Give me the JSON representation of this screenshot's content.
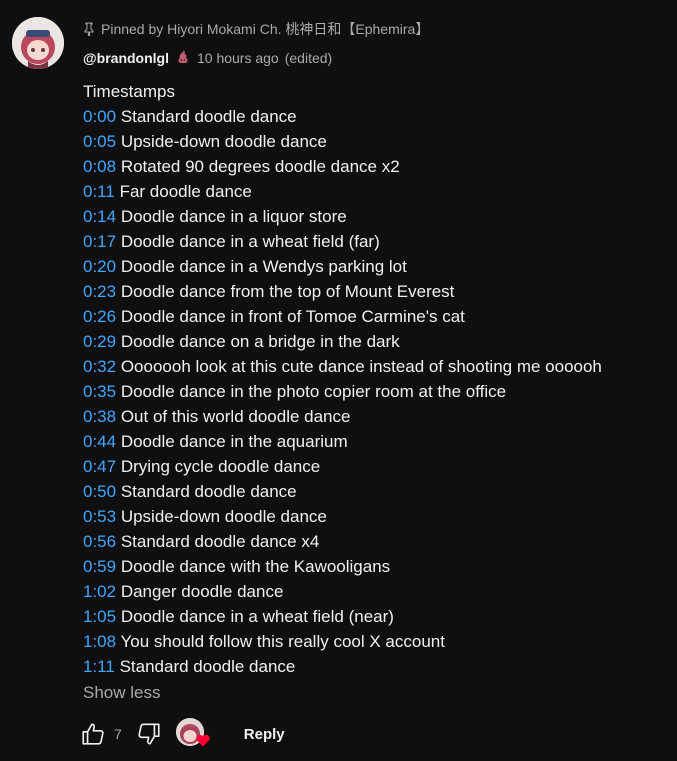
{
  "comment": {
    "pinned_text": "Pinned by Hiyori Mokami Ch. 桃神日和【Ephemira】",
    "author_handle": "@brandonlgl",
    "time_ago": "10 hours ago",
    "edited_label": "(edited)",
    "intro": "Timestamps",
    "timestamps": [
      {
        "time": "0:00",
        "desc": "Standard doodle dance"
      },
      {
        "time": "0:05",
        "desc": "Upside-down doodle dance"
      },
      {
        "time": "0:08",
        "desc": "Rotated 90 degrees doodle dance x2"
      },
      {
        "time": "0:11",
        "desc": "Far doodle dance"
      },
      {
        "time": "0:14",
        "desc": "Doodle dance in a liquor store"
      },
      {
        "time": "0:17",
        "desc": "Doodle dance in a wheat field (far)"
      },
      {
        "time": "0:20",
        "desc": "Doodle dance in a Wendys parking lot"
      },
      {
        "time": "0:23",
        "desc": "Doodle dance from the top of Mount Everest"
      },
      {
        "time": "0:26",
        "desc": "Doodle dance in front of Tomoe Carmine's cat"
      },
      {
        "time": "0:29",
        "desc": "Doodle dance on a bridge in the dark"
      },
      {
        "time": "0:32",
        "desc": "Ooooooh look at this cute dance instead of shooting me oooooh"
      },
      {
        "time": "0:35",
        "desc": "Doodle dance in the photo copier room at the office"
      },
      {
        "time": "0:38",
        "desc": "Out of this world doodle dance"
      },
      {
        "time": "0:44",
        "desc": "Doodle dance in the aquarium"
      },
      {
        "time": "0:47",
        "desc": "Drying cycle doodle dance"
      },
      {
        "time": "0:50",
        "desc": "Standard doodle dance"
      },
      {
        "time": "0:53",
        "desc": "Upside-down doodle dance"
      },
      {
        "time": "0:56",
        "desc": "Standard doodle dance x4"
      },
      {
        "time": "0:59",
        "desc": "Doodle dance with the Kawooligans"
      },
      {
        "time": "1:02",
        "desc": "Danger doodle dance"
      },
      {
        "time": "1:05",
        "desc": "Doodle dance in a wheat field (near)"
      },
      {
        "time": "1:08",
        "desc": "You should follow this really cool X account"
      },
      {
        "time": "1:11",
        "desc": "Standard doodle dance"
      }
    ],
    "show_less_label": "Show less",
    "like_count": "7",
    "reply_label": "Reply"
  },
  "icons": {
    "pin": "pin-icon",
    "like": "thumbs-up-icon",
    "dislike": "thumbs-down-icon",
    "heart": "heart-icon",
    "badge": "member-badge-icon"
  },
  "colors": {
    "background": "#0f0f0f",
    "text": "#f1f1f1",
    "secondary": "#aaaaaa",
    "link": "#3ea6ff",
    "heart": "#ff0033"
  }
}
